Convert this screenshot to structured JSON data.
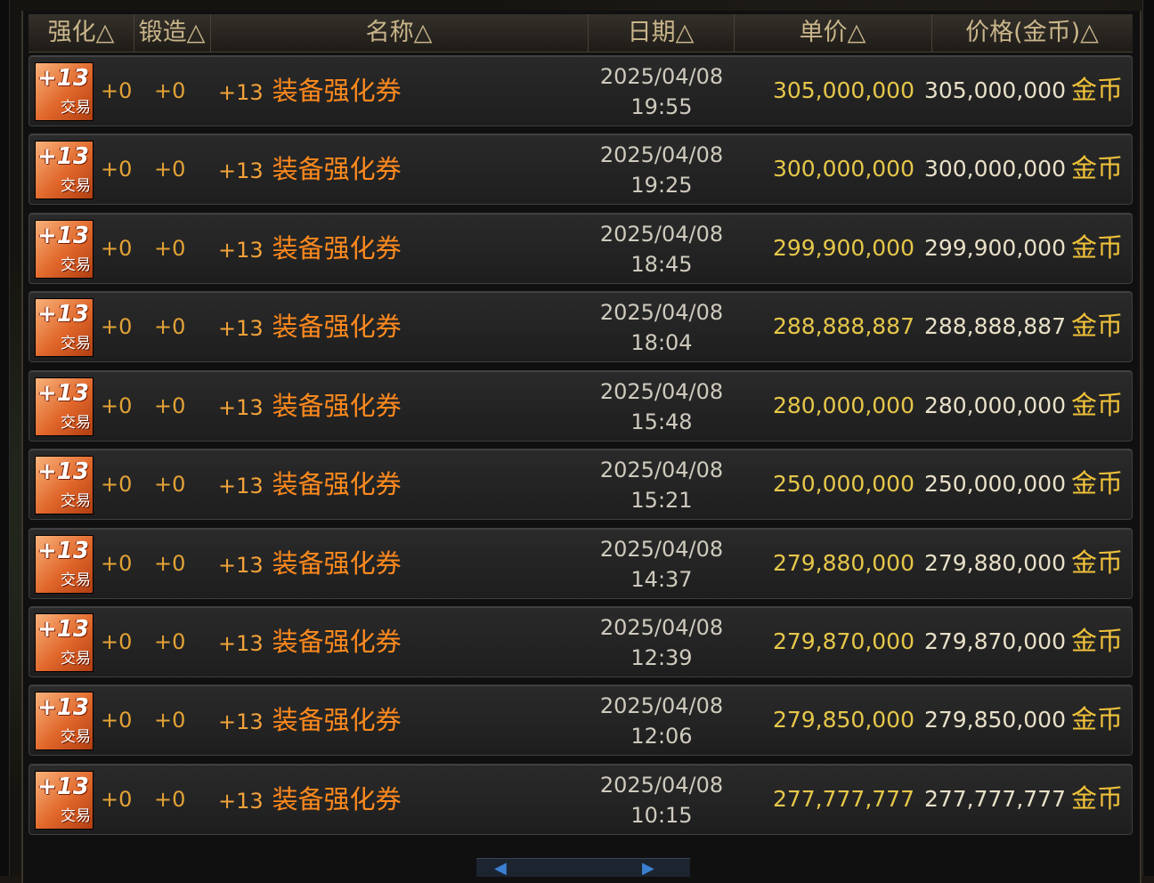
{
  "header": {
    "cols": [
      "强化△",
      "锻造△",
      "名称△",
      "日期△",
      "单价△",
      "价格(金币)△"
    ]
  },
  "rows": [
    {
      "icon_top": "+13",
      "icon_bottom": "交易",
      "enhance": "+0",
      "forge": "+0",
      "level": "+13",
      "name": "装备强化券",
      "date": "2025/04/08",
      "time": "19:55",
      "unit_price": "305,000,000",
      "total_price": "305,000,000",
      "currency": "金币"
    },
    {
      "icon_top": "+13",
      "icon_bottom": "交易",
      "enhance": "+0",
      "forge": "+0",
      "level": "+13",
      "name": "装备强化券",
      "date": "2025/04/08",
      "time": "19:25",
      "unit_price": "300,000,000",
      "total_price": "300,000,000",
      "currency": "金币"
    },
    {
      "icon_top": "+13",
      "icon_bottom": "交易",
      "enhance": "+0",
      "forge": "+0",
      "level": "+13",
      "name": "装备强化券",
      "date": "2025/04/08",
      "time": "18:45",
      "unit_price": "299,900,000",
      "total_price": "299,900,000",
      "currency": "金币"
    },
    {
      "icon_top": "+13",
      "icon_bottom": "交易",
      "enhance": "+0",
      "forge": "+0",
      "level": "+13",
      "name": "装备强化券",
      "date": "2025/04/08",
      "time": "18:04",
      "unit_price": "288,888,887",
      "total_price": "288,888,887",
      "currency": "金币"
    },
    {
      "icon_top": "+13",
      "icon_bottom": "交易",
      "enhance": "+0",
      "forge": "+0",
      "level": "+13",
      "name": "装备强化券",
      "date": "2025/04/08",
      "time": "15:48",
      "unit_price": "280,000,000",
      "total_price": "280,000,000",
      "currency": "金币"
    },
    {
      "icon_top": "+13",
      "icon_bottom": "交易",
      "enhance": "+0",
      "forge": "+0",
      "level": "+13",
      "name": "装备强化券",
      "date": "2025/04/08",
      "time": "15:21",
      "unit_price": "250,000,000",
      "total_price": "250,000,000",
      "currency": "金币"
    },
    {
      "icon_top": "+13",
      "icon_bottom": "交易",
      "enhance": "+0",
      "forge": "+0",
      "level": "+13",
      "name": "装备强化券",
      "date": "2025/04/08",
      "time": "14:37",
      "unit_price": "279,880,000",
      "total_price": "279,880,000",
      "currency": "金币"
    },
    {
      "icon_top": "+13",
      "icon_bottom": "交易",
      "enhance": "+0",
      "forge": "+0",
      "level": "+13",
      "name": "装备强化券",
      "date": "2025/04/08",
      "time": "12:39",
      "unit_price": "279,870,000",
      "total_price": "279,870,000",
      "currency": "金币"
    },
    {
      "icon_top": "+13",
      "icon_bottom": "交易",
      "enhance": "+0",
      "forge": "+0",
      "level": "+13",
      "name": "装备强化券",
      "date": "2025/04/08",
      "time": "12:06",
      "unit_price": "279,850,000",
      "total_price": "279,850,000",
      "currency": "金币"
    },
    {
      "icon_top": "+13",
      "icon_bottom": "交易",
      "enhance": "+0",
      "forge": "+0",
      "level": "+13",
      "name": "装备强化券",
      "date": "2025/04/08",
      "time": "10:15",
      "unit_price": "277,777,777",
      "total_price": "277,777,777",
      "currency": "金币"
    }
  ],
  "pager": {
    "prev_icon": "prev-arrow-icon",
    "next_icon": "next-arrow-icon"
  }
}
